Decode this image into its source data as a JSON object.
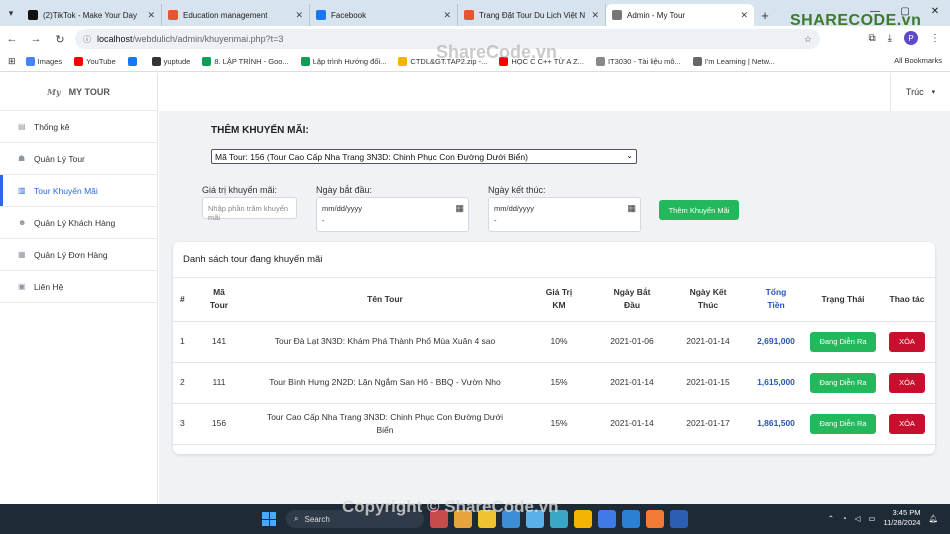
{
  "browser": {
    "tabs": [
      {
        "label": "(2)TikTok - Make Your Day",
        "color": "#111111",
        "width": 140
      },
      {
        "label": "Education management",
        "color": "#e2572b",
        "width": 148
      },
      {
        "label": "Facebook",
        "color": "#1877f2",
        "width": 148
      },
      {
        "label": "Trang Đặt Tour Du Lịch Việt Nam",
        "color": "#e2572b",
        "width": 148
      },
      {
        "label": "Admin - My Tour",
        "color": "#777777",
        "width": 148,
        "active": true
      }
    ],
    "new_tab": "+",
    "url_host": "localhost",
    "url_path": "/webdulich/admin/khuyenmai.php?t=3",
    "profile_initial": "P",
    "bookmarks": [
      {
        "label": "Images",
        "color": "#4285f4"
      },
      {
        "label": "YouTube",
        "color": "#ff0000"
      },
      {
        "label": "",
        "color": "#1877f2"
      },
      {
        "label": "yuptude",
        "color": "#333333"
      },
      {
        "label": "8. LẬP TRÌNH - Goo...",
        "color": "#0f9d58"
      },
      {
        "label": "Lập trình Hướng đối...",
        "color": "#0f9d58"
      },
      {
        "label": "CTDL&GT.TAP2.zip -...",
        "color": "#f4b400"
      },
      {
        "label": "HỌC C C++ TỪ A Z...",
        "color": "#ff0000"
      },
      {
        "label": "IT3030 - Tài liệu mô...",
        "color": "#888888"
      },
      {
        "label": "I'm Learning | Netw...",
        "color": "#666666"
      }
    ],
    "all_bookmarks": "All Bookmarks"
  },
  "sidebar": {
    "brand": "MY TOUR",
    "logo_text": "My",
    "items": [
      {
        "label": "Thống kê",
        "icon": "chart-icon",
        "active": false
      },
      {
        "label": "Quản Lý Tour",
        "icon": "tour-icon",
        "active": false
      },
      {
        "label": "Tour Khuyến Mãi",
        "icon": "bar-chart-icon",
        "active": true
      },
      {
        "label": "Quản Lý Khách Hàng",
        "icon": "users-icon",
        "active": false
      },
      {
        "label": "Quản Lý Đơn Hàng",
        "icon": "orders-icon",
        "active": false
      },
      {
        "label": "Liên Hệ",
        "icon": "contact-icon",
        "active": false
      }
    ]
  },
  "header": {
    "user": "Trúc"
  },
  "form": {
    "title": "THÊM KHUYẾN MÃI:",
    "selected_tour": "Mã Tour: 156 (Tour Cao Cấp Nha Trang 3N3D: Chinh Phục Con Đường Dưới Biển)",
    "discount_label": "Giá trị khuyến mãi:",
    "discount_placeholder": "Nhập phần trăm khuyến mãi",
    "start_label": "Ngày bắt đầu:",
    "end_label": "Ngày kết thúc:",
    "date_placeholder": "mm/dd/yyyy",
    "date_dash": "-",
    "submit": "Thêm Khuyến Mãi"
  },
  "table": {
    "title": "Danh sách tour đang khuyến mãi",
    "headers": {
      "index": "#",
      "code": "Mã\nTour",
      "name": "Tên Tour",
      "discount": "Giá Trị\nKM",
      "start": "Ngày Bắt\nĐầu",
      "end": "Ngày Kết\nThúc",
      "total": "Tổng\nTiền",
      "status": "Trạng Thái",
      "action": "Thao tác"
    },
    "rows": [
      {
        "index": "1",
        "code": "141",
        "name": "Tour Đà Lạt 3N3D: Khám Phá Thành Phố Mùa Xuân 4 sao",
        "discount": "10%",
        "start": "2021-01-06",
        "end": "2021-01-14",
        "total": "2,691,000",
        "status": "Đang Diễn Ra",
        "action": "XÓA"
      },
      {
        "index": "2",
        "code": "111",
        "name": "Tour Bình Hưng 2N2D: Lặn Ngắm San Hô - BBQ - Vườn Nho",
        "discount": "15%",
        "start": "2021-01-14",
        "end": "2021-01-15",
        "total": "1,615,000",
        "status": "Đang Diễn Ra",
        "action": "XÓA"
      },
      {
        "index": "3",
        "code": "156",
        "name": "Tour Cao Cấp Nha Trang 3N3D: Chinh Phục Con Đường Dưới Biển",
        "discount": "15%",
        "start": "2021-01-14",
        "end": "2021-01-17",
        "total": "1,861,500",
        "status": "Đang Diễn Ra",
        "action": "XÓA"
      }
    ]
  },
  "taskbar": {
    "search": "Search",
    "time": "3:45 PM",
    "date": "11/28/2024",
    "app_colors": [
      "#c84b4b",
      "#e8a33d",
      "#f1c232",
      "#3c8fd6",
      "#5ab0e8",
      "#38a7c8",
      "#f4b400",
      "#3f7be6",
      "#2b7fd4",
      "#f27b35",
      "#2b5fb4"
    ]
  },
  "watermarks": {
    "logo": "SHARECODE.vn",
    "center": "ShareCode.vn",
    "footer": "Copyright © ShareCode.vn"
  }
}
